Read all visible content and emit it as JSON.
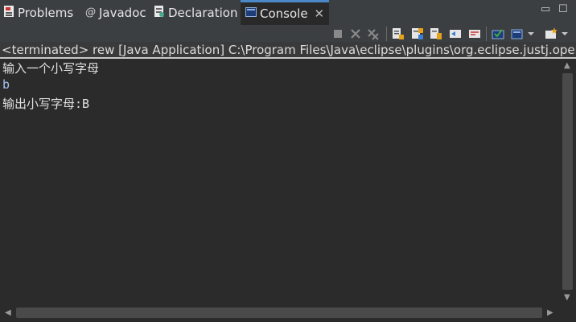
{
  "tabs": [
    {
      "label": "Problems",
      "icon": "problems-icon",
      "active": false
    },
    {
      "label": "Javadoc",
      "icon": "javadoc-icon",
      "active": false
    },
    {
      "label": "Declaration",
      "icon": "declaration-icon",
      "active": false
    },
    {
      "label": "Console",
      "icon": "console-icon",
      "active": true
    }
  ],
  "tab_close_glyph": "✕",
  "window_controls": {
    "minimize": "▭",
    "maximize": "☐"
  },
  "toolbar_icons": [
    "terminate-icon",
    "remove-launch-icon",
    "remove-all-terminated-icon",
    "show-console-stdout-icon",
    "show-console-stderr-icon",
    "pin-console-icon",
    "scroll-lock-icon",
    "word-wrap-icon",
    "display-selected-console-icon",
    "open-console-icon"
  ],
  "console": {
    "header": "<terminated> rew [Java Application] C:\\Program Files\\Java\\eclipse\\plugins\\org.eclipse.justj.openjdk",
    "lines": [
      {
        "text": "输入一个小写字母",
        "kind": "output"
      },
      {
        "text": "b",
        "kind": "input"
      },
      {
        "text": "输出小写字母:B",
        "kind": "output"
      }
    ]
  },
  "colors": {
    "accent": "#4a88c7",
    "background": "#2b2b2b",
    "input_text": "#a9c0f0",
    "output_text": "#e0e0e0"
  }
}
